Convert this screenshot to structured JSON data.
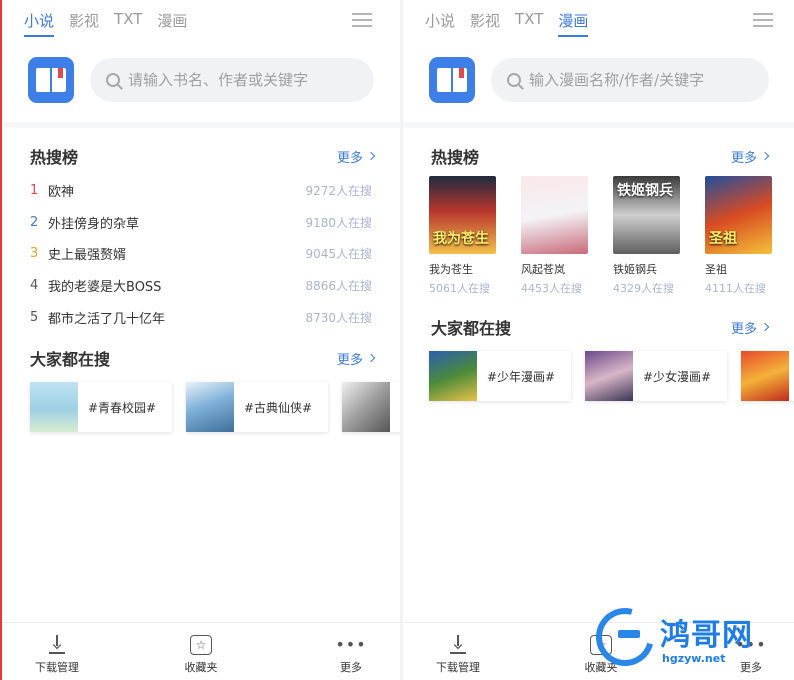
{
  "left": {
    "tabs": [
      {
        "label": "小说",
        "active": true
      },
      {
        "label": "影视",
        "active": false
      },
      {
        "label": "TXT",
        "active": false
      },
      {
        "label": "漫画",
        "active": false
      }
    ],
    "search_placeholder": "请输入书名、作者或关键字",
    "hot": {
      "title": "热搜榜",
      "more": "更多",
      "items": [
        {
          "no": "1",
          "title": "欧神",
          "count": "9272人在搜",
          "no_color": "#e5484d"
        },
        {
          "no": "2",
          "title": "外挂傍身的杂草",
          "count": "9180人在搜",
          "no_color": "#3b7be0"
        },
        {
          "no": "3",
          "title": "史上最强赘婿",
          "count": "9045人在搜",
          "no_color": "#f0a020"
        },
        {
          "no": "4",
          "title": "我的老婆是大BOSS",
          "count": "8866人在搜",
          "no_color": "#555555"
        },
        {
          "no": "5",
          "title": "都市之活了几十亿年",
          "count": "8730人在搜",
          "no_color": "#555555"
        }
      ]
    },
    "everyone": {
      "title": "大家都在搜",
      "more": "更多",
      "tags": [
        {
          "label": "#青春校园#"
        },
        {
          "label": "#古典仙侠#"
        },
        {
          "label": ""
        }
      ]
    }
  },
  "right": {
    "tabs": [
      {
        "label": "小说",
        "active": false
      },
      {
        "label": "影视",
        "active": false
      },
      {
        "label": "TXT",
        "active": false
      },
      {
        "label": "漫画",
        "active": true
      }
    ],
    "search_placeholder": "输入漫画名称/作者/关键字",
    "hot": {
      "title": "热搜榜",
      "more": "更多",
      "comics": [
        {
          "name": "我为苍生",
          "count": "5061人在搜",
          "cover_label": "我为苍生"
        },
        {
          "name": "风起苍岚",
          "count": "4453人在搜",
          "cover_label": ""
        },
        {
          "name": "铁姬钢兵",
          "count": "4329人在搜",
          "cover_label": "铁姬钢兵"
        },
        {
          "name": "圣祖",
          "count": "4111人在搜",
          "cover_label": "圣祖"
        }
      ]
    },
    "everyone": {
      "title": "大家都在搜",
      "more": "更多",
      "tags": [
        {
          "label": "#少年漫画#"
        },
        {
          "label": "#少女漫画#"
        },
        {
          "label": ""
        }
      ]
    }
  },
  "bottom_nav": [
    {
      "label": "下载管理",
      "icon": "download-icon"
    },
    {
      "label": "收藏夹",
      "icon": "favorites-icon"
    },
    {
      "label": "更多",
      "icon": "more-dots-icon"
    }
  ],
  "watermark": {
    "text": "鸿哥网",
    "url": "hgzyw.net"
  },
  "colors": {
    "accent": "#3b7be0",
    "logo": "#3d7fe6",
    "count": "#a9b6cc"
  }
}
